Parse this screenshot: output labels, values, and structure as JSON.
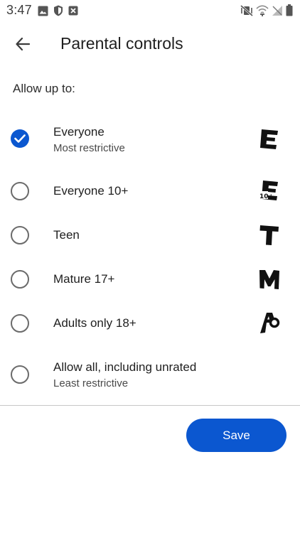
{
  "status_bar": {
    "time": "3:47",
    "left_icons": [
      "image-icon",
      "shield-icon",
      "close-box-icon"
    ],
    "right_icons": [
      "vibrate-off-icon",
      "wifi-icon",
      "signal-icon",
      "battery-icon"
    ]
  },
  "app_bar": {
    "back_icon": "arrow-back-icon",
    "title": "Parental controls"
  },
  "allow_label": "Allow up to:",
  "options": [
    {
      "title": "Everyone",
      "subtitle": "Most restrictive",
      "checked": true,
      "badge": "E"
    },
    {
      "title": "Everyone 10+",
      "subtitle": "",
      "checked": false,
      "badge": "E10+"
    },
    {
      "title": "Teen",
      "subtitle": "",
      "checked": false,
      "badge": "T"
    },
    {
      "title": "Mature 17+",
      "subtitle": "",
      "checked": false,
      "badge": "M"
    },
    {
      "title": "Adults only 18+",
      "subtitle": "",
      "checked": false,
      "badge": "AO"
    },
    {
      "title": "Allow all, including unrated",
      "subtitle": "Least restrictive",
      "checked": false,
      "badge": ""
    }
  ],
  "save_label": "Save",
  "colors": {
    "accent": "#0b57d0",
    "text_primary": "#1f1f1f",
    "text_secondary": "#4a4a4a",
    "divider": "#c7c7c7"
  }
}
